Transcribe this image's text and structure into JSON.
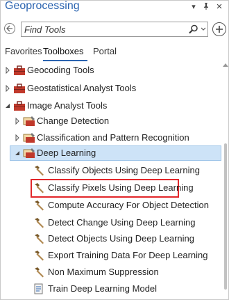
{
  "window": {
    "title": "Geoprocessing",
    "menu_icon": "▾",
    "pin_icon": "pin",
    "close_icon": "×"
  },
  "search": {
    "placeholder": "Find Tools",
    "value": ""
  },
  "tabs": [
    {
      "label": "Favorites",
      "active": false
    },
    {
      "label": "Toolboxes",
      "active": true
    },
    {
      "label": "Portal",
      "active": false
    }
  ],
  "tree": {
    "geocoding": "Geocoding Tools",
    "geostatistical": "Geostatistical Analyst Tools",
    "image_analyst": "Image Analyst Tools",
    "change_detection": "Change Detection",
    "classification": "Classification and Pattern Recognition",
    "deep_learning": "Deep Learning",
    "tools": [
      "Classify Objects Using Deep Learning",
      "Classify Pixels Using Deep Learning",
      "Compute Accuracy For Object Detection",
      "Detect Change Using Deep Learning",
      "Detect Objects Using Deep Learning",
      "Export Training Data For Deep Learning",
      "Non Maximum Suppression",
      "Train Deep Learning Model"
    ]
  },
  "colors": {
    "accent": "#2b64b0",
    "selection": "#cde3f7",
    "highlight": "#e2262a",
    "toolbox_red": "#c0392b"
  }
}
